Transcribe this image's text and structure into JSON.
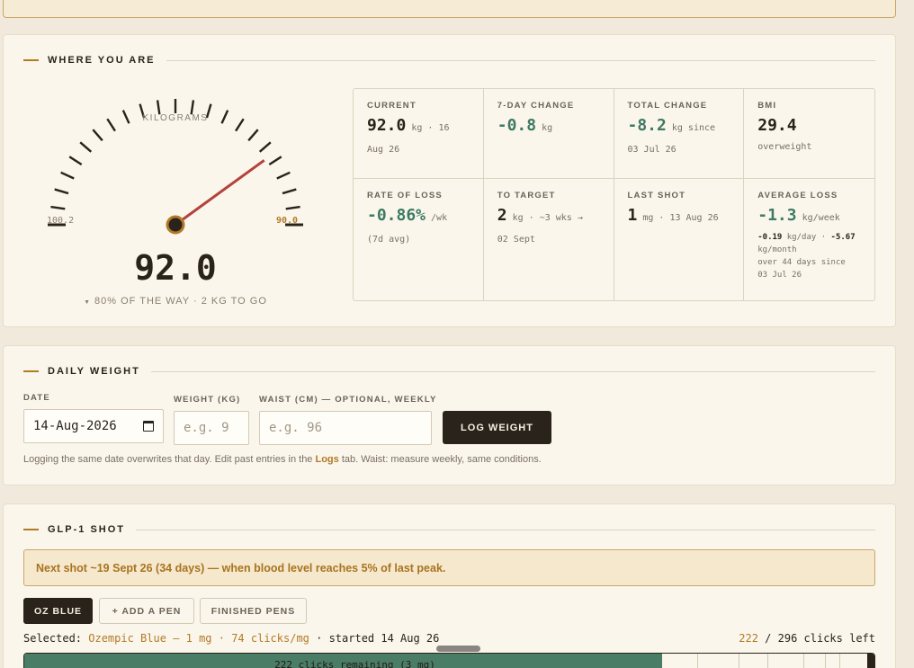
{
  "where": {
    "section_title": "WHERE YOU ARE",
    "gauge": {
      "unit_label": "KILOGRAMS",
      "min_label": "100.2",
      "max_label": "90.0",
      "value": "92.0",
      "progress_fraction": 0.8,
      "progress_text": "80% OF THE WAY · 2 KG TO GO",
      "progress_icon": "triangle-down-icon",
      "needle_color": "#b5423a"
    },
    "stats": [
      {
        "label": "CURRENT",
        "value": "92.0",
        "unit": "kg · 16",
        "sub": "Aug 26",
        "tone": "dark"
      },
      {
        "label": "7-DAY CHANGE",
        "value": "-0.8",
        "unit": "kg",
        "sub": "",
        "tone": "green"
      },
      {
        "label": "TOTAL CHANGE",
        "value": "-8.2",
        "unit": "kg since",
        "sub": "03 Jul 26",
        "tone": "green"
      },
      {
        "label": "BMI",
        "value": "29.4",
        "unit": "",
        "sub": "overweight",
        "tone": "dark"
      },
      {
        "label": "RATE OF LOSS",
        "value": "-0.86%",
        "unit": "/wk",
        "sub": "(7d avg)",
        "tone": "green"
      },
      {
        "label": "TO TARGET",
        "value": "2",
        "unit": "kg · ~3 wks →",
        "sub": "02 Sept",
        "tone": "dark"
      },
      {
        "label": "LAST SHOT",
        "value": "1",
        "unit": "mg · 13 Aug 26",
        "sub": "",
        "tone": "dark"
      },
      {
        "label": "AVERAGE LOSS",
        "value": "-1.3",
        "unit": "kg/week",
        "sub_day": "-0.19",
        "sub_day_unit": "kg/day ·",
        "sub_month": "-5.67",
        "sub_month_unit": "kg/month",
        "sub_over": "over 44 days since",
        "sub_since": "03 Jul 26",
        "tone": "green"
      }
    ]
  },
  "daily": {
    "section_title": "DAILY WEIGHT",
    "date_label": "DATE",
    "date_value": "14-Aug-2026",
    "weight_label": "WEIGHT (KG)",
    "weight_placeholder": "e.g. 9",
    "waist_label": "WAIST (CM) — OPTIONAL, WEEKLY",
    "waist_placeholder": "e.g. 96",
    "log_button": "LOG WEIGHT",
    "help_before": "Logging the same date overwrites that day. Edit past entries in the ",
    "help_link": "Logs",
    "help_after": " tab. Waist: measure weekly, same conditions."
  },
  "shot": {
    "section_title": "GLP-1 SHOT",
    "alert": "Next shot ~19 Sept 26 (34 days) — when blood level reaches 5% of last peak.",
    "pens": [
      "OZ BLUE",
      "+ ADD A PEN",
      "FINISHED PENS"
    ],
    "selected_prefix": "Selected: ",
    "selected_pen": "Ozempic Blue — 1 mg · 74 clicks/mg",
    "selected_suffix": " · started 14 Aug 26",
    "clicks_remaining_value": "222",
    "clicks_total_text": " / 296 clicks left",
    "bar_text": "222 clicks remaining (3 mg)",
    "remaining_fraction": 0.75
  },
  "colors": {
    "accent": "#b37a26",
    "green": "#3e7a64",
    "dark": "#2a231b",
    "bar_fill": "#4a7d66"
  }
}
